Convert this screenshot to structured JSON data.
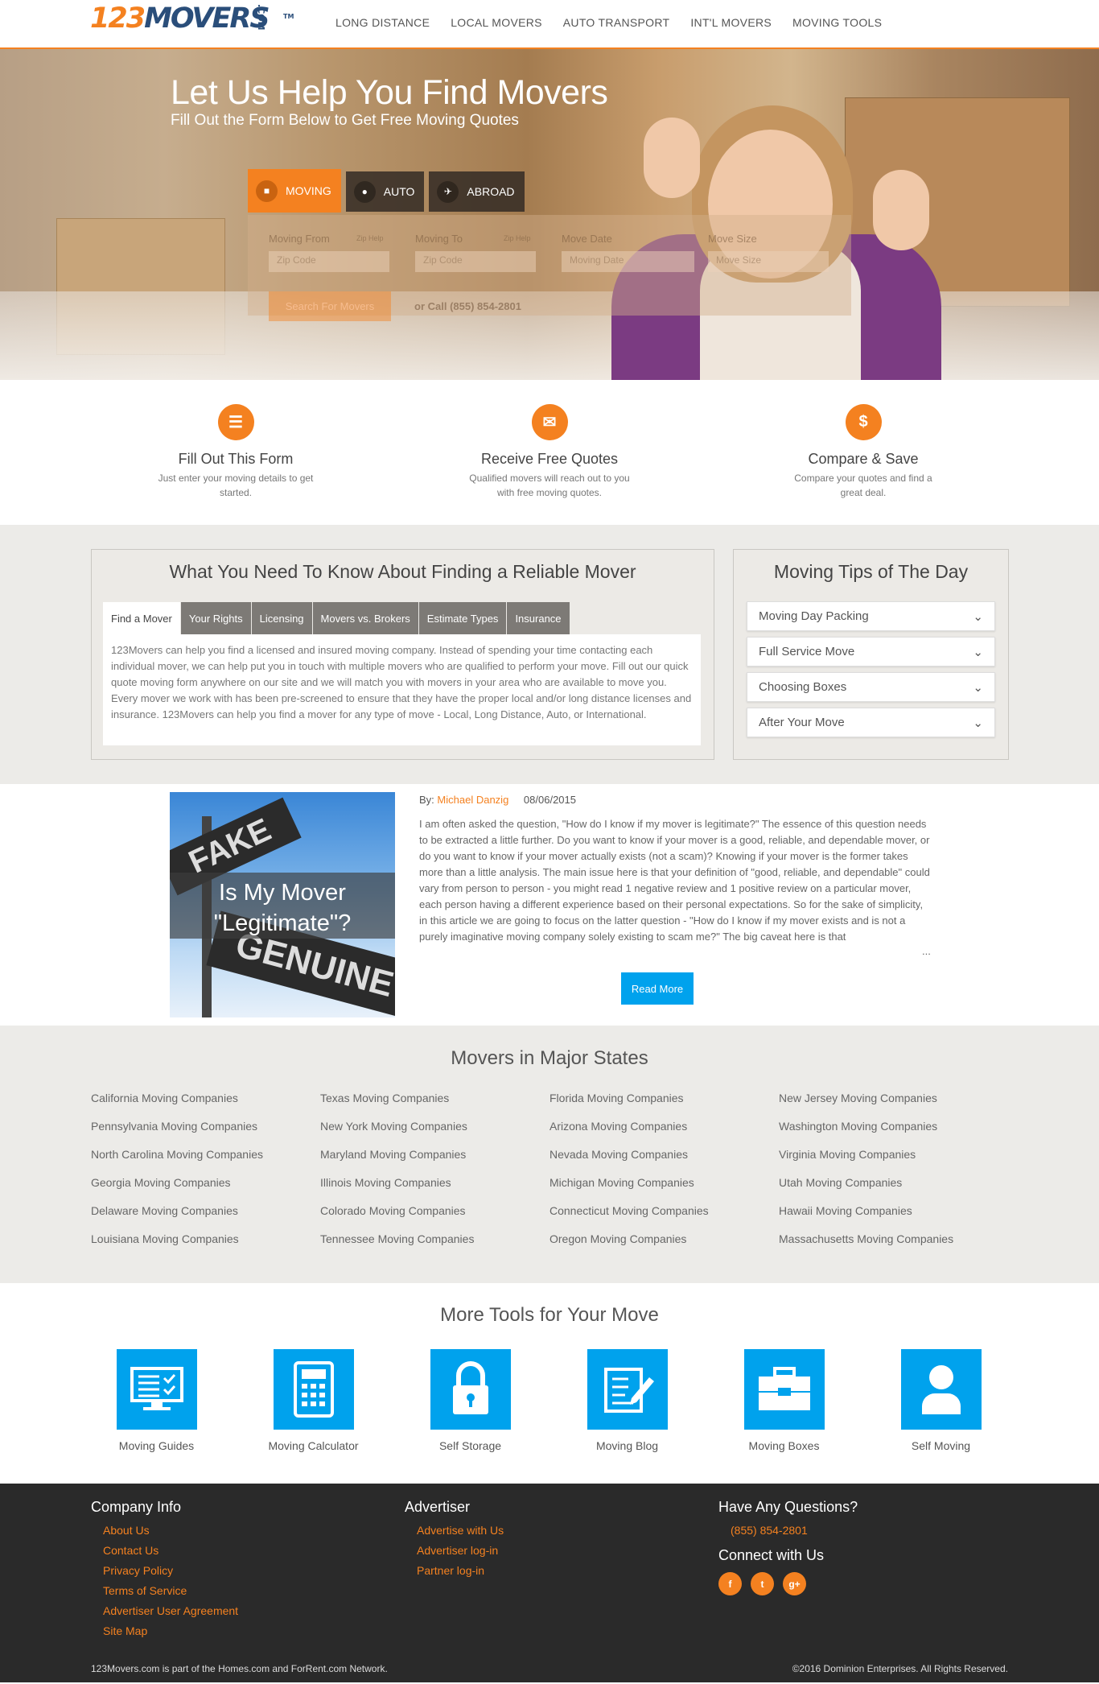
{
  "header": {
    "logo_num": "123",
    "logo_word": "MOVERS",
    "logo_com": ".COM",
    "logo_tm": "TM",
    "nav": [
      "LONG DISTANCE",
      "LOCAL MOVERS",
      "AUTO TRANSPORT",
      "INT'L MOVERS",
      "MOVING TOOLS"
    ]
  },
  "hero": {
    "title_prefix": "Let Us Help You Find",
    "title_emph": "Movers",
    "subtitle": "Fill Out the Form Below to Get Free Moving Quotes",
    "tabs": [
      {
        "label": "MOVING",
        "icon": "truck-icon"
      },
      {
        "label": "AUTO",
        "icon": "car-icon"
      },
      {
        "label": "ABROAD",
        "icon": "plane-icon"
      }
    ],
    "form": {
      "from_label": "Moving From",
      "from_help": "Zip Help",
      "from_placeholder": "Zip Code",
      "to_label": "Moving To",
      "to_help": "Zip Help",
      "to_placeholder": "Zip Code",
      "date_label": "Move Date",
      "date_placeholder": "Moving Date",
      "size_label": "Move Size",
      "size_placeholder": "Move Size",
      "search_button": "Search For Movers",
      "call_text": "or Call (855) 854-2801"
    }
  },
  "steps": [
    {
      "title": "Fill Out This Form",
      "desc": "Just enter your moving details to get started.",
      "icon": "document-icon"
    },
    {
      "title": "Receive Free Quotes",
      "desc": "Qualified movers will reach out to you with free moving quotes.",
      "icon": "envelope-icon"
    },
    {
      "title": "Compare & Save",
      "desc": "Compare your quotes and find a great deal.",
      "icon": "dollar-icon"
    }
  ],
  "know": {
    "title": "What You Need To Know About Finding a Reliable Mover",
    "tabs": [
      "Find a Mover",
      "Your Rights",
      "Licensing",
      "Movers vs. Brokers",
      "Estimate Types",
      "Insurance"
    ],
    "body": "123Movers can help you find a licensed and insured moving company. Instead of spending your time contacting each individual mover, we can help put you in touch with multiple movers who are qualified to perform your move. Fill out our quick quote moving form anywhere on our site and we will match you with movers in your area who are available to move you. Every mover we work with has been pre-screened to ensure that they have the proper local and/or long distance licenses and insurance. 123Movers can help you find a mover for any type of move - Local, Long Distance, Auto, or International."
  },
  "tips": {
    "title": "Moving Tips of The Day",
    "items": [
      "Moving Day Packing",
      "Full Service Move",
      "Choosing Boxes",
      "After Your Move"
    ]
  },
  "article": {
    "image_caption": "Is My Mover \"Legitimate\"?",
    "sign_top": "FAKE",
    "sign_bottom": "GENUINE",
    "by_label": "By:",
    "author": "Michael Danzig",
    "date": "08/06/2015",
    "text": "I am often asked the question, \"How do I know if my mover is legitimate?\" The essence of this question needs to be extracted a little further. Do you want to know if your mover is a good, reliable, and dependable mover, or do you want to know if your mover actually exists (not a scam)? Knowing if your mover is the former takes more than a little analysis. The main issue here is that your definition of \"good, reliable, and dependable\" could vary from person to person - you might read 1 negative review and 1 positive review on a particular mover, each person having a different experience based on their personal expectations. So for the sake of simplicity, in this article we are going to focus on the latter question - \"How do I know if my mover exists and is not a purely imaginative moving company solely existing to scam me?\" The big caveat here is that",
    "ellipsis": "...",
    "read_more": "Read More"
  },
  "states": {
    "title": "Movers in Major States",
    "links": [
      "California Moving Companies",
      "Texas Moving Companies",
      "Florida Moving Companies",
      "New Jersey Moving Companies",
      "Pennsylvania Moving Companies",
      "New York Moving Companies",
      "Arizona Moving Companies",
      "Washington Moving Companies",
      "North Carolina Moving Companies",
      "Maryland Moving Companies",
      "Nevada Moving Companies",
      "Virginia Moving Companies",
      "Georgia Moving Companies",
      "Illinois Moving Companies",
      "Michigan Moving Companies",
      "Utah Moving Companies",
      "Delaware Moving Companies",
      "Colorado Moving Companies",
      "Connecticut Moving Companies",
      "Hawaii Moving Companies",
      "Louisiana Moving Companies",
      "Tennessee Moving Companies",
      "Oregon Moving Companies",
      "Massachusetts Moving Companies"
    ]
  },
  "tools": {
    "title": "More Tools for Your Move",
    "items": [
      {
        "label": "Moving Guides",
        "icon": "monitor-checklist-icon"
      },
      {
        "label": "Moving Calculator",
        "icon": "calculator-icon"
      },
      {
        "label": "Self Storage",
        "icon": "padlock-icon"
      },
      {
        "label": "Moving Blog",
        "icon": "pencil-note-icon"
      },
      {
        "label": "Moving Boxes",
        "icon": "toolbox-icon"
      },
      {
        "label": "Self Moving",
        "icon": "person-icon"
      }
    ]
  },
  "footer": {
    "company_title": "Company Info",
    "company_links": [
      "About Us",
      "Contact Us",
      "Privacy Policy",
      "Terms of Service",
      "Advertiser User Agreement",
      "Site Map"
    ],
    "advertiser_title": "Advertiser",
    "advertiser_links": [
      "Advertise with Us",
      "Advertiser log-in",
      "Partner log-in"
    ],
    "questions_title": "Have Any Questions?",
    "phone": "(855) 854-2801",
    "connect_title": "Connect with Us",
    "social": [
      {
        "glyph": "f",
        "icon": "facebook-icon"
      },
      {
        "glyph": "t",
        "icon": "twitter-icon"
      },
      {
        "glyph": "g+",
        "icon": "google-plus-icon"
      }
    ],
    "network_text": "123Movers.com is part of the Homes.com and ForRent.com Network.",
    "copyright": "©2016 Dominion Enterprises. All Rights Reserved."
  },
  "colors": {
    "accent": "#f48120",
    "brand_blue": "#2a4e7a",
    "tool_blue": "#00a2ed",
    "footer_bg": "#2a2a2a"
  }
}
